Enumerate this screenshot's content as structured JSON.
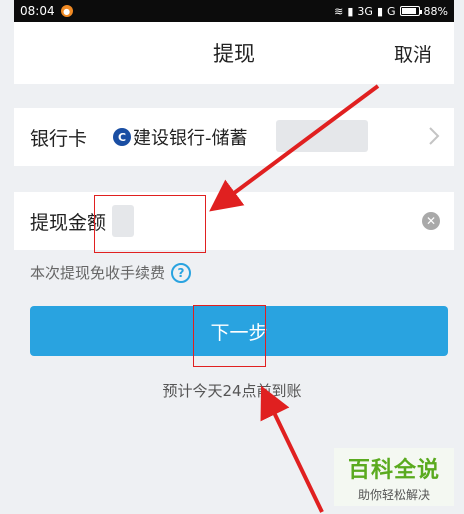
{
  "status_bar": {
    "time": "08:04",
    "network": "3G",
    "network2": "G",
    "battery": "88%"
  },
  "nav": {
    "title": "提现",
    "cancel": "取消"
  },
  "bank_row": {
    "label": "银行卡",
    "bank_name": "建设银行-储蓄"
  },
  "amount_row": {
    "label": "提现金额",
    "value": ""
  },
  "fee_note": "本次提现免收手续费",
  "next_button": "下一步",
  "eta": "预计今天24点前到账",
  "watermark": {
    "title": "百科全说",
    "subtitle": "助你轻松解决"
  },
  "colors": {
    "accent": "#29a3e0",
    "annotation": "#e02020",
    "bank_logo": "#1a4ea3"
  }
}
